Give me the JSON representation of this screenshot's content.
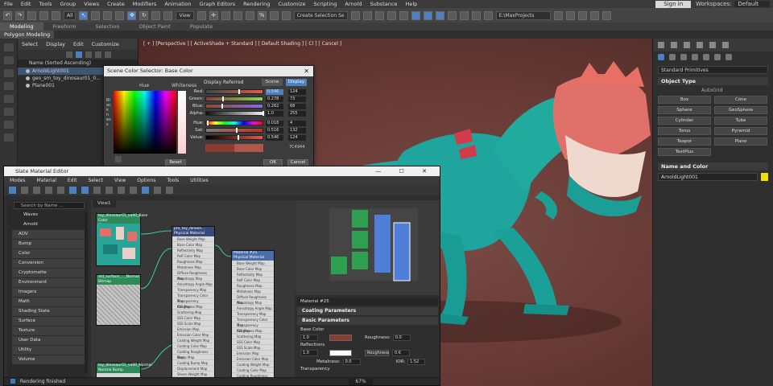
{
  "menu": [
    "File",
    "Edit",
    "Tools",
    "Group",
    "Views",
    "Create",
    "Modifiers",
    "Animation",
    "Graph Editors",
    "Rendering",
    "Customize",
    "Scripting",
    "Arnold",
    "Substance",
    "Help"
  ],
  "account": {
    "sign_in": "Sign in",
    "workspaces_label": "Workspaces:",
    "workspace": "Default"
  },
  "toolbar": {
    "filter": "All",
    "view": "View",
    "selection_set": "Create Selection Se",
    "project_path": "E:\\MaxProjects"
  },
  "ribbon": {
    "tabs": [
      "Modeling",
      "Freeform",
      "Selection",
      "Object Paint",
      "Populate"
    ],
    "sub": "Polygon Modeling"
  },
  "explorer": {
    "tabs": [
      "Select",
      "Display",
      "Edit",
      "Customize"
    ],
    "header": "Name (Sorted Ascending)",
    "items": [
      "ArnoldLight001",
      "geo_sm_toy_dinosaur01_0...",
      "Plane001"
    ]
  },
  "viewport": {
    "label": "[ + ] [Perspective ] [ ActiveShade + Standard ] [ Default Shading ] [ Cl ] [ Cancel ]"
  },
  "color_dialog": {
    "title": "Scene Color Selector: Base Color",
    "hue": "Hue",
    "whiteness": "Whiteness",
    "blackness": "Blackness",
    "display_referred": "Display Referred",
    "scene_btn": "Scene",
    "display_btn": "Display",
    "rows": [
      {
        "label": "Red:",
        "v1": "0.546",
        "v2": "124"
      },
      {
        "label": "Green:",
        "v1": "0.278",
        "v2": "73"
      },
      {
        "label": "Blue:",
        "v1": "0.262",
        "v2": "68"
      },
      {
        "label": "Alpha:",
        "v1": "1.0",
        "v2": "255"
      },
      {
        "label": "Hue:",
        "v1": "0.018",
        "v2": "4"
      },
      {
        "label": "Sat:",
        "v1": "0.516",
        "v2": "132"
      },
      {
        "label": "Value:",
        "v1": "0.546",
        "v2": "124"
      }
    ],
    "hex": "7C4944",
    "reset": "Reset",
    "ok": "OK",
    "cancel": "Cancel",
    "colors": {
      "red_slider": "#c23a2a",
      "green_slider": "#5ea84a",
      "blue_slider": "#5a7cc8"
    }
  },
  "slate": {
    "title": "Slate Material Editor",
    "window_controls": "—  ☐  ✕",
    "menu": [
      "Modes",
      "Material",
      "Edit",
      "Select",
      "View",
      "Options",
      "Tools",
      "Utilities"
    ],
    "search": "Search by Name ...",
    "categories": [
      "Waves",
      "Arnold",
      "AOV",
      "Bump",
      "Color",
      "Conversion",
      "Cryptomatte",
      "Environment",
      "Imagers",
      "Math",
      "Shading State",
      "Surface",
      "Texture",
      "User Data",
      "Utility",
      "Volume"
    ],
    "view_tab": "View1",
    "nodes": [
      {
        "title": "toy_dinosaur01_va00_Base Color",
        "sub": "Bitmap"
      },
      {
        "title": "std_surface_..._Normal",
        "sub": "Bitmap"
      },
      {
        "title": "pro_toy_dinosa... Physical Material",
        "sub": ""
      },
      {
        "title": "Material #25",
        "sub": "Physical Material"
      },
      {
        "title": "toy_dinosaur01_va00_Normal",
        "sub": "Normal Bump"
      }
    ],
    "node_ports": [
      "Base Weight Map",
      "Base Color Map",
      "Reflectivity Map",
      "Refl Color Map",
      "Roughness Map",
      "Metalness Map",
      "Diffuse Roughness Map",
      "Anisotropy Map",
      "Anisotropy Angle Map",
      "Transparency Map",
      "Transparency Color Map",
      "Transparency Roughness Map",
      "IOR Map",
      "Scattering Map",
      "SSS Color Map",
      "SSS Scale Map",
      "Emission Map",
      "Emission Color Map",
      "Coating Weight Map",
      "Coating Color Map",
      "Coating Roughness Map",
      "Bump Map",
      "Coating Bump Map",
      "Displacement Map",
      "Sheen Weight Map",
      "Sheen Color Map",
      "Sheen Roughness Map",
      "Thin Film Map",
      "Bump Map"
    ],
    "props": {
      "material": "Material #25",
      "coating": "Coating Parameters",
      "basic": "Basic Parameters",
      "base_color": "Base Color",
      "base_weight": "1.0",
      "roughness_label": "Roughness:",
      "roughness": "0.0",
      "reflections": "Reflections",
      "refl_weight": "1.0",
      "refl_mode": "Roughness",
      "refl_rough": "0.6",
      "metalness_label": "Metalness:",
      "metalness": "0.0",
      "ior_label": "IOR:",
      "ior": "1.52",
      "transparency": "Transparency",
      "base_swatch": "#8c3b30",
      "refl_swatch": "#ffffff"
    },
    "status": "Rendering finished",
    "zoom": "67%"
  },
  "command_panel": {
    "dropdown": "Standard Primitives",
    "object_type": "Object Type",
    "autogrid": "AutoGrid",
    "primitives": [
      "Box",
      "Cone",
      "Sphere",
      "GeoSphere",
      "Cylinder",
      "Tube",
      "Torus",
      "Pyramid",
      "Teapot",
      "Plane",
      "TextPlus"
    ],
    "name_and_color": "Name and Color",
    "object_name": "ArnoldLight001",
    "object_color": "#f2e000"
  }
}
